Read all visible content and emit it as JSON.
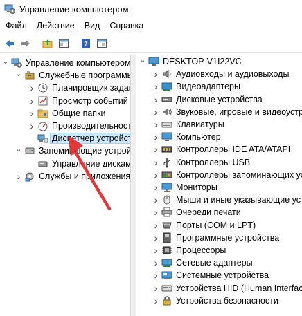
{
  "window": {
    "title": "Управление компьютером"
  },
  "menu": [
    "Файл",
    "Действие",
    "Вид",
    "Справка"
  ],
  "toolbar": {
    "buttons": [
      "back-arrow-icon",
      "forward-arrow-icon",
      "up-folder-icon",
      "show-hide-tree-icon",
      "help-icon",
      "properties-icon"
    ]
  },
  "left_tree": [
    {
      "label": "Управление компьютером (л",
      "level": 0,
      "expanded": true,
      "icon": "computer-management-icon"
    },
    {
      "label": "Служебные программы",
      "level": 1,
      "expanded": true,
      "icon": "tools-icon"
    },
    {
      "label": "Планировщик заданий",
      "level": 2,
      "expanded": false,
      "icon": "clock-icon"
    },
    {
      "label": "Просмотр событий",
      "level": 2,
      "expanded": false,
      "icon": "event-viewer-icon"
    },
    {
      "label": "Общие папки",
      "level": 2,
      "expanded": false,
      "icon": "shared-folder-icon"
    },
    {
      "label": "Производительность",
      "level": 2,
      "expanded": false,
      "icon": "performance-icon"
    },
    {
      "label": "Диспетчер устройств",
      "level": 2,
      "expanded": null,
      "icon": "device-manager-icon",
      "selected": true
    },
    {
      "label": "Запоминающие устройст",
      "level": 1,
      "expanded": true,
      "icon": "storage-icon"
    },
    {
      "label": "Управление дисками",
      "level": 2,
      "expanded": null,
      "icon": "disk-management-icon"
    },
    {
      "label": "Службы и приложения",
      "level": 1,
      "expanded": false,
      "icon": "services-icon"
    }
  ],
  "right_tree": {
    "root": {
      "label": "DESKTOP-V1I22VC",
      "icon": "computer-icon"
    },
    "items": [
      {
        "label": "Аудиовходы и аудиовыходы",
        "icon": "audio-icon"
      },
      {
        "label": "Видеоадаптеры",
        "icon": "display-adapter-icon"
      },
      {
        "label": "Дисковые устройства",
        "icon": "disk-drive-icon"
      },
      {
        "label": "Звуковые, игровые и видеоустр",
        "icon": "sound-icon"
      },
      {
        "label": "Клавиатуры",
        "icon": "keyboard-icon"
      },
      {
        "label": "Компьютер",
        "icon": "computer-icon"
      },
      {
        "label": "Контроллеры IDE ATA/ATAPI",
        "icon": "ide-controller-icon"
      },
      {
        "label": "Контроллеры USB",
        "icon": "usb-icon"
      },
      {
        "label": "Контроллеры запоминающих устр",
        "icon": "storage-controller-icon"
      },
      {
        "label": "Мониторы",
        "icon": "monitor-icon"
      },
      {
        "label": "Мыши и иные указывающие устр",
        "icon": "mouse-icon"
      },
      {
        "label": "Очереди печати",
        "icon": "printer-icon"
      },
      {
        "label": "Порты (COM и LPT)",
        "icon": "port-icon"
      },
      {
        "label": "Программные устройства",
        "icon": "software-device-icon"
      },
      {
        "label": "Процессоры",
        "icon": "processor-icon"
      },
      {
        "label": "Сетевые адаптеры",
        "icon": "network-adapter-icon"
      },
      {
        "label": "Системные устройства",
        "icon": "system-device-icon"
      },
      {
        "label": "Устройства HID (Human Interface",
        "icon": "hid-icon"
      },
      {
        "label": "Устройства безопасности",
        "icon": "security-device-icon"
      }
    ]
  },
  "colors": {
    "accent_arrow": "#e2383a",
    "selection_bg": "#cce8ff",
    "selection_border": "#99d1ff"
  }
}
